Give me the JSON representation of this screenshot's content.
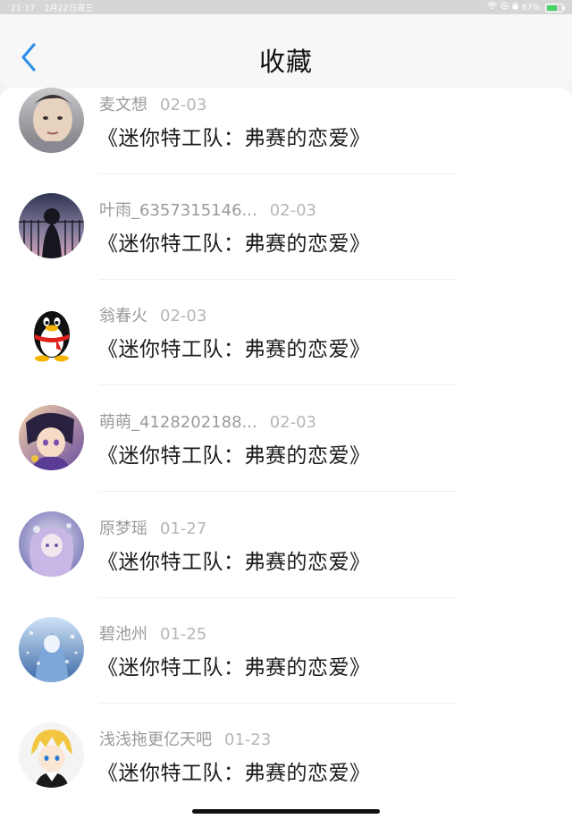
{
  "status_bar": {
    "time": "21:17",
    "date": "2月22日周三",
    "battery": "67%",
    "battery_level": 0.67
  },
  "header": {
    "title": "收藏"
  },
  "favorites": [
    {
      "name": "麦文想",
      "date": "02-03",
      "title": "《迷你特工队：弗赛的恋爱》"
    },
    {
      "name": "叶雨_6357315146...",
      "date": "02-03",
      "title": "《迷你特工队：弗赛的恋爱》"
    },
    {
      "name": "翁春火",
      "date": "02-03",
      "title": "《迷你特工队：弗赛的恋爱》"
    },
    {
      "name": "萌萌_4128202188...",
      "date": "02-03",
      "title": "《迷你特工队：弗赛的恋爱》"
    },
    {
      "name": "原梦瑶",
      "date": "01-27",
      "title": "《迷你特工队：弗赛的恋爱》"
    },
    {
      "name": "碧池州",
      "date": "01-25",
      "title": "《迷你特工队：弗赛的恋爱》"
    },
    {
      "name": "浅浅拖更亿天吧",
      "date": "01-23",
      "title": "《迷你特工队：弗赛的恋爱》"
    }
  ],
  "colors": {
    "accent": "#2f8fe8",
    "primary_text": "#1c1c1c",
    "secondary_text": "#9a9a9a"
  }
}
